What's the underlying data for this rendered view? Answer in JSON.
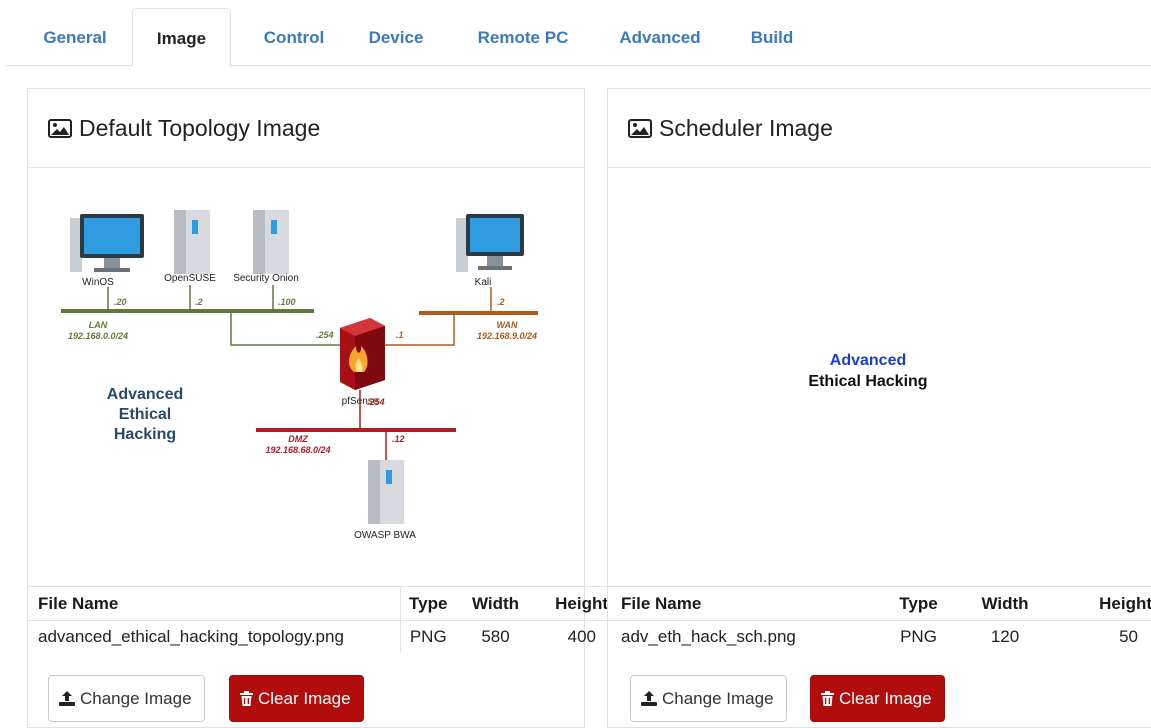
{
  "tabs": [
    {
      "label": "General",
      "active": false
    },
    {
      "label": "Image",
      "active": true
    },
    {
      "label": "Control",
      "active": false
    },
    {
      "label": "Device",
      "active": false
    },
    {
      "label": "Remote PC",
      "active": false
    },
    {
      "label": "Advanced",
      "active": false
    },
    {
      "label": "Build",
      "active": false
    }
  ],
  "topology_card": {
    "title": "Default Topology Image",
    "diagram": {
      "nodes": [
        "WinOS",
        "OpenSUSE",
        "Security Onion",
        "Kali",
        "pfSense",
        "OWASP BWA"
      ],
      "host_labels": [
        ".20",
        ".2",
        ".100",
        ".2",
        ".254",
        ".1",
        ".254",
        ".12"
      ],
      "lan_name": "LAN",
      "lan_net": "192.168.0.0/24",
      "wan_name": "WAN",
      "wan_net": "192.168.9.0/24",
      "dmz_name": "DMZ",
      "dmz_net": "192.168.68.0/24",
      "heading_lines": [
        "Advanced",
        "Ethical",
        "Hacking"
      ]
    },
    "table": {
      "headers": [
        "File Name",
        "Type",
        "Width",
        "Height"
      ],
      "row": [
        "advanced_ethical_hacking_topology.png",
        "PNG",
        "580",
        "400"
      ]
    },
    "buttons": {
      "change": "Change Image",
      "clear": "Clear Image"
    }
  },
  "scheduler_card": {
    "title": "Scheduler Image",
    "image_text": {
      "line1": "Advanced",
      "line2": "Ethical Hacking"
    },
    "table": {
      "headers": [
        "File Name",
        "Type",
        "Width",
        "Height"
      ],
      "row": [
        "adv_eth_hack_sch.png",
        "PNG",
        "120",
        "50"
      ]
    },
    "buttons": {
      "change": "Change Image",
      "clear": "Clear Image"
    }
  },
  "colors": {
    "tab_link": "#3a7bbf",
    "danger": "#b20d0d",
    "lan": "#5f7a3a",
    "wan": "#b05a1a",
    "dmz": "#b21a22",
    "scheduler_blue": "#1f3bd8"
  }
}
